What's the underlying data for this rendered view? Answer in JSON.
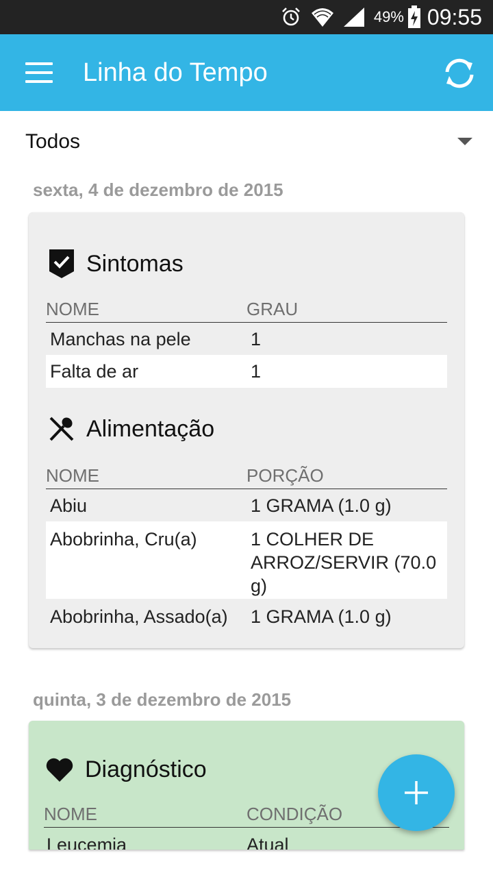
{
  "status_bar": {
    "battery": "49%",
    "time": "09:55"
  },
  "app_bar": {
    "title": "Linha do Tempo"
  },
  "filter": {
    "selected": "Todos"
  },
  "day1": {
    "date": "sexta, 4 de dezembro de 2015",
    "symptoms": {
      "title": "Sintomas",
      "col_name": "NOME",
      "col_value": "GRAU",
      "rows": [
        {
          "name": "Manchas na pele",
          "value": "1"
        },
        {
          "name": "Falta de ar",
          "value": "1"
        }
      ]
    },
    "food": {
      "title": "Alimentação",
      "col_name": "NOME",
      "col_value": "PORÇÃO",
      "rows": [
        {
          "name": "Abiu",
          "value": "1 GRAMA (1.0 g)"
        },
        {
          "name": "Abobrinha, Cru(a)",
          "value_l1": "1 COLHER DE",
          "value_l2": "ARROZ/SERVIR (70.0",
          "value_l3": "g)"
        },
        {
          "name": "Abobrinha, Assado(a)",
          "value": "1 GRAMA (1.0 g)"
        }
      ]
    }
  },
  "day2": {
    "date": "quinta, 3 de dezembro de 2015",
    "diagnosis": {
      "title": "Diagnóstico",
      "col_name": "NOME",
      "col_value": "CONDIÇÃO",
      "rows": [
        {
          "name": "Leucemia",
          "value": "Atual"
        }
      ]
    }
  },
  "icons": {
    "alarm": "alarm-icon",
    "wifi": "wifi-icon",
    "signal": "signal-icon",
    "battery": "battery-icon",
    "menu": "menu-icon",
    "refresh": "refresh-icon",
    "symptoms": "shield-check-icon",
    "food": "fork-spoon-icon",
    "diagnosis": "heart-icon",
    "add": "plus-icon"
  },
  "colors": {
    "primary": "#33b5e5",
    "status_bar": "#232323",
    "card_gray": "#eeeeee",
    "card_green": "#c8e6c9",
    "date_text": "#9a9a9a"
  }
}
